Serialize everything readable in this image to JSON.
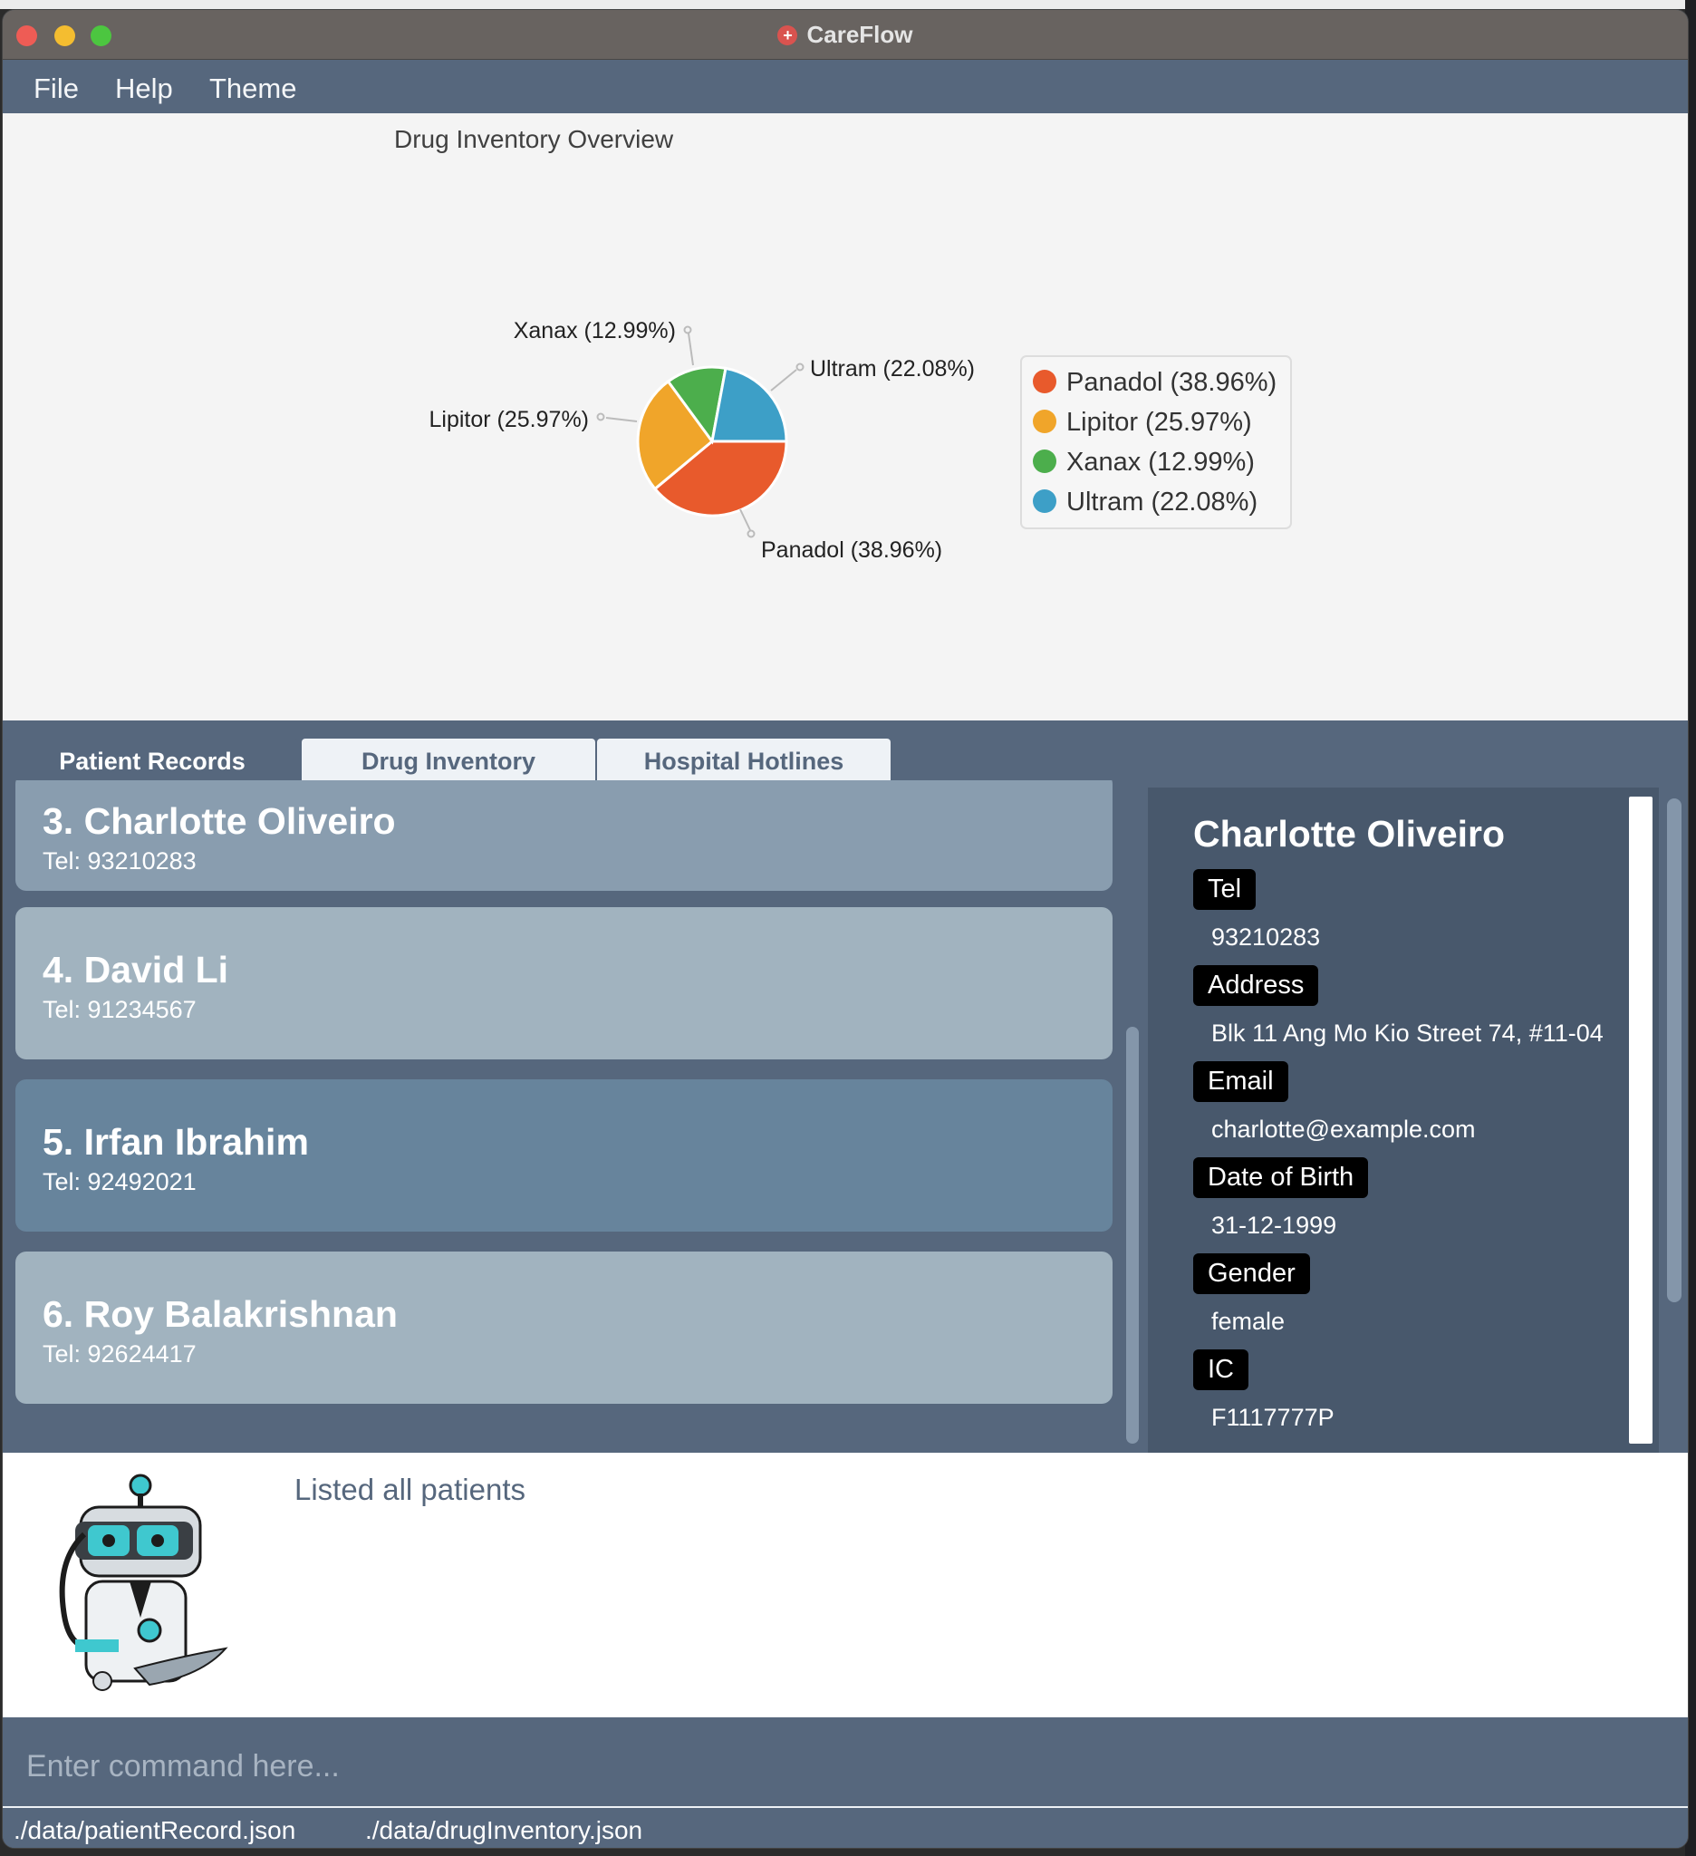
{
  "window": {
    "title": "CareFlow"
  },
  "menu": {
    "file": "File",
    "help": "Help",
    "theme": "Theme"
  },
  "chart_data": {
    "type": "pie",
    "title": "Drug Inventory Overview",
    "slices": [
      {
        "label": "Panadol (38.96%)",
        "value": 38.96,
        "color": "#e85a2c"
      },
      {
        "label": "Lipitor (25.97%)",
        "value": 25.97,
        "color": "#f0a52a"
      },
      {
        "label": "Xanax (12.99%)",
        "value": 12.99,
        "color": "#4cae4c"
      },
      {
        "label": "Ultram (22.08%)",
        "value": 22.08,
        "color": "#3d9fc7"
      }
    ],
    "legend": [
      "Panadol (38.96%)",
      "Lipitor (25.97%)",
      "Xanax (12.99%)",
      "Ultram (22.08%)"
    ],
    "legend_position": "right"
  },
  "tabs": [
    {
      "label": "Patient Records"
    },
    {
      "label": "Drug Inventory"
    },
    {
      "label": "Hospital Hotlines"
    }
  ],
  "patients": [
    {
      "name": "3.  Charlotte Oliveiro",
      "tel": "Tel: 93210283"
    },
    {
      "name": "4.  David Li",
      "tel": "Tel: 91234567"
    },
    {
      "name": "5.  Irfan Ibrahim",
      "tel": "Tel: 92492021"
    },
    {
      "name": "6.  Roy Balakrishnan",
      "tel": "Tel: 92624417"
    }
  ],
  "detail": {
    "name": "Charlotte Oliveiro",
    "fields": [
      {
        "label": "Tel",
        "value": "93210283"
      },
      {
        "label": "Address",
        "value": "Blk 11 Ang Mo Kio Street 74, #11-04"
      },
      {
        "label": "Email",
        "value": "charlotte@example.com"
      },
      {
        "label": "Date of Birth",
        "value": "31-12-1999"
      },
      {
        "label": "Gender",
        "value": "female"
      },
      {
        "label": "IC",
        "value": "F1117777P"
      }
    ]
  },
  "result": {
    "text": "Listed all patients"
  },
  "command": {
    "placeholder": "Enter command here..."
  },
  "status": {
    "patient_file": "./data/patientRecord.json",
    "drug_file": "./data/drugInventory.json"
  },
  "colors": {
    "accent": "#56677d",
    "panel_dark": "#48586c"
  }
}
